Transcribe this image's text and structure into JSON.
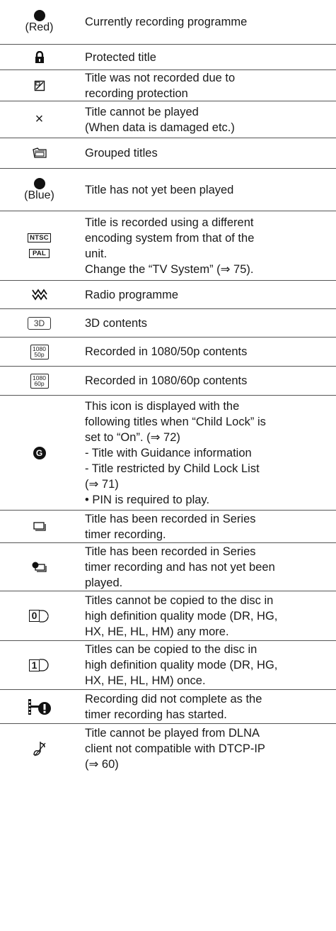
{
  "rows": [
    {
      "icon": "red-dot-icon",
      "icon_label": "(Red)",
      "lines": [
        "Currently recording programme"
      ]
    },
    {
      "icon": "lock-icon",
      "lines": [
        "Protected title"
      ]
    },
    {
      "icon": "no-copy-icon",
      "lines": [
        "Title was not recorded due to",
        "recording protection"
      ]
    },
    {
      "icon": "cross-icon",
      "icon_text": "×",
      "lines": [
        "Title cannot be played",
        "(When data is damaged etc.)"
      ]
    },
    {
      "icon": "grouped-titles-icon",
      "lines": [
        "Grouped titles"
      ]
    },
    {
      "icon": "blue-dot-icon",
      "icon_label": "(Blue)",
      "lines": [
        "Title has not yet been played"
      ]
    },
    {
      "icon": "ntsc-pal-icon",
      "icon_tags": [
        "NTSC",
        "PAL"
      ],
      "lines": [
        "Title is recorded using a different",
        "encoding system from that of the",
        "unit.",
        "Change the “TV System” (⇒ 75)."
      ]
    },
    {
      "icon": "radio-icon",
      "lines": [
        "Radio programme"
      ]
    },
    {
      "icon": "3d-icon",
      "icon_text": "3D",
      "lines": [
        "3D contents"
      ]
    },
    {
      "icon": "1080-50p-icon",
      "icon_text": "1080",
      "icon_sub": "50p",
      "lines": [
        "Recorded in 1080/50p contents"
      ]
    },
    {
      "icon": "1080-60p-icon",
      "icon_text": "1080",
      "icon_sub": "60p",
      "lines": [
        "Recorded in 1080/60p contents"
      ]
    },
    {
      "icon": "guidance-g-icon",
      "icon_text": "G",
      "lines": [
        "This icon is displayed with the",
        "following titles when “Child Lock” is",
        "set to “On”. (⇒ 72)",
        "- Title with Guidance information",
        "- Title restricted by Child Lock List",
        "(⇒ 71)",
        "• PIN is required to play."
      ]
    },
    {
      "icon": "series-timer-icon",
      "lines": [
        "Title has been recorded in Series",
        "timer recording."
      ]
    },
    {
      "icon": "series-timer-unplayed-icon",
      "lines": [
        "Title has been recorded in Series",
        "timer recording and has not yet been",
        "played."
      ]
    },
    {
      "icon": "copy-zero-icon",
      "icon_text": "0",
      "lines": [
        "Titles cannot be copied to the disc in",
        "high definition quality mode (DR, HG,",
        "HX, HE, HL, HM) any more."
      ]
    },
    {
      "icon": "copy-once-icon",
      "icon_text": "1",
      "lines": [
        "Titles can be copied to the disc in",
        "high definition quality mode (DR, HG,",
        "HX, HE, HL, HM) once."
      ]
    },
    {
      "icon": "recording-incomplete-icon",
      "lines": [
        "Recording did not complete as the",
        "timer recording has started."
      ]
    },
    {
      "icon": "dlna-restricted-icon",
      "lines": [
        "Title cannot be played from DLNA",
        "client not compatible with DTCP-IP",
        "(⇒ 60)"
      ]
    }
  ]
}
